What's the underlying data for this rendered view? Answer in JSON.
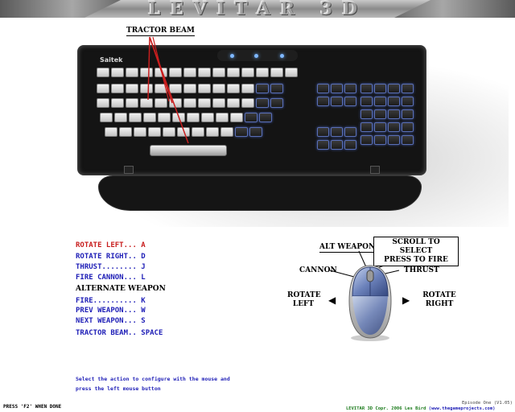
{
  "banner": {
    "title": "LEVITAR 3D"
  },
  "callouts": {
    "tractor_beam": "TRACTOR BEAM",
    "alt_weapon": "ALT WEAPON",
    "scroll_line1": "SCROLL TO SELECT",
    "scroll_line2": "PRESS TO FIRE",
    "cannon": "CANNON",
    "thrust": "THRUST",
    "rotate_left_line1": "ROTATE",
    "rotate_left_line2": "LEFT",
    "rotate_right_line1": "ROTATE",
    "rotate_right_line2": "RIGHT"
  },
  "keyboard": {
    "brand": "Saitek",
    "accent_color": "#6aaeff"
  },
  "bindings": {
    "rotate_left": "ROTATE LEFT... A",
    "rotate_right": "ROTATE RIGHT.. D",
    "thrust": "THRUST........ J",
    "fire_cannon": "FIRE CANNON... L",
    "alt_header": "ALTERNATE WEAPON",
    "fire": "FIRE.......... K",
    "prev_weapon": "PREV WEAPON... W",
    "next_weapon": "NEXT WEAPON... S",
    "tractor_beam": "TRACTOR BEAM.. SPACE"
  },
  "instructions": "Select the action to configure with the mouse and press the left mouse button",
  "footer": {
    "left": "PRESS 'F2' WHEN DONE",
    "episode": "Episode One (V1.05)",
    "credit": "LEVITAR 3D Copr. 2006 Les Bird",
    "url": "(www.thegameprojects.com)"
  },
  "colors": {
    "binding_text": "#1f1fb7",
    "selected_binding": "#c81e1e",
    "credit": "#1a7a1a"
  }
}
